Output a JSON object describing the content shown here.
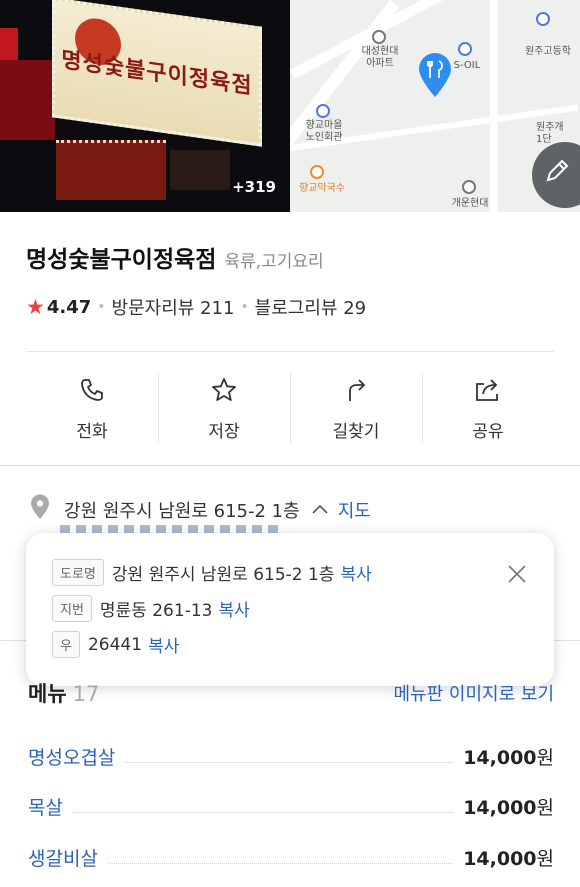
{
  "hero": {
    "photo_count": "+319",
    "sign_text": "명성숯불구이정육점",
    "map_labels": {
      "apt1": "대성현대\n아파트",
      "soil": "S-OIL",
      "apt2": "원주고등학",
      "village": "향교마을\n노인회관",
      "noodle": "향교막국수",
      "hyundai": "개운현대",
      "apt3": "원주개\n1단"
    }
  },
  "place": {
    "name": "명성숯불구이정육점",
    "category": "육류,고기요리",
    "rating": "4.47",
    "visitor_reviews": "방문자리뷰 211",
    "blog_reviews": "블로그리뷰 29"
  },
  "actions": [
    {
      "label": "전화",
      "icon": "phone-icon"
    },
    {
      "label": "저장",
      "icon": "star-icon"
    },
    {
      "label": "길찾기",
      "icon": "directions-icon"
    },
    {
      "label": "공유",
      "icon": "share-icon"
    }
  ],
  "address": {
    "summary": "강원 원주시 남원로 615-2 1층",
    "map_link": "지도",
    "road_tag": "도로명",
    "road": "강원 원주시 남원로 615-2 1층",
    "lot_tag": "지번",
    "lot": "명륜동 261-13",
    "zip_tag": "우",
    "zip": "26441",
    "copy": "복사"
  },
  "menu": {
    "title": "메뉴",
    "count": "17",
    "more": "메뉴판 이미지로 보기",
    "items": [
      {
        "name": "명성오겹살",
        "price": "14,000",
        "unit": "원"
      },
      {
        "name": "목살",
        "price": "14,000",
        "unit": "원"
      },
      {
        "name": "생갈비살",
        "price": "14,000",
        "unit": "원"
      }
    ]
  },
  "colors": {
    "accent_blue": "#2a63b8",
    "star_red": "#e8443a",
    "map_pin": "#2f8df0"
  }
}
